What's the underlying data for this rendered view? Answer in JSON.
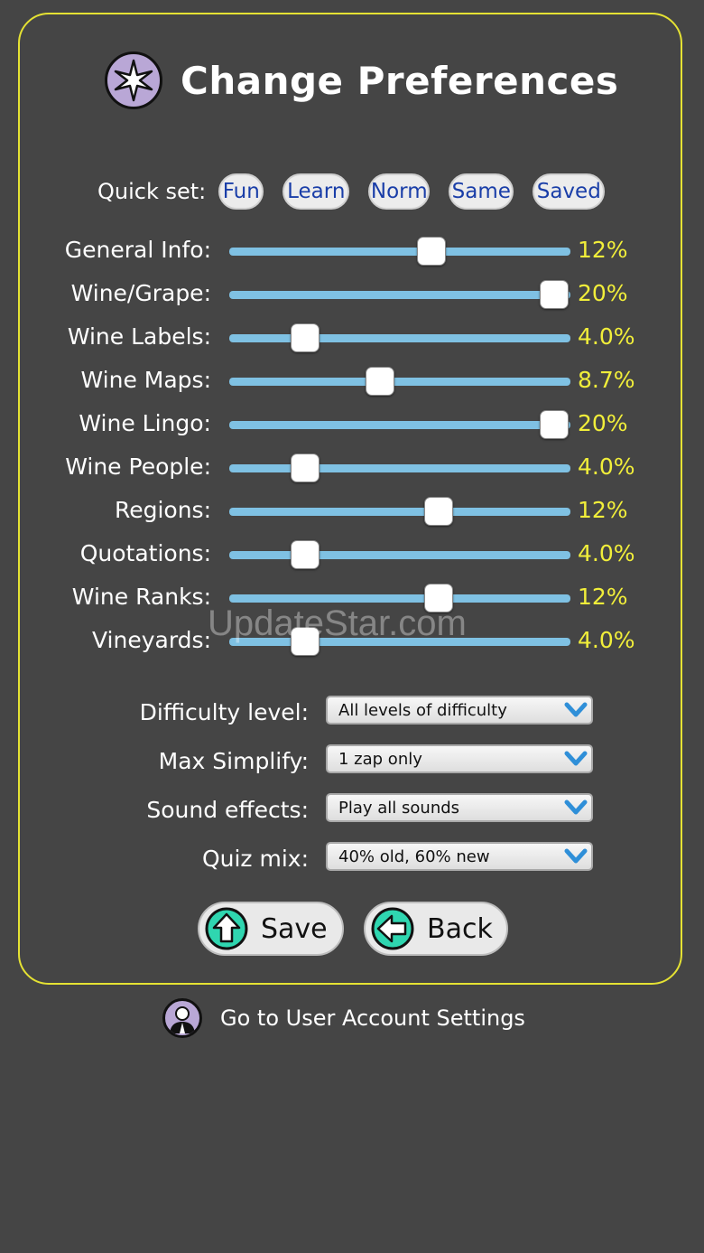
{
  "header": {
    "title": "Change Preferences",
    "icon": "star-compass-icon"
  },
  "quick_set": {
    "label": "Quick set:",
    "options": [
      "Fun",
      "Learn",
      "Norm",
      "Same",
      "Saved"
    ]
  },
  "sliders": [
    {
      "label": "General Info:",
      "value": "12%",
      "level": 0.59
    },
    {
      "label": "Wine/Grape:",
      "value": "20%",
      "level": 0.95
    },
    {
      "label": "Wine Labels:",
      "value": "4.0%",
      "level": 0.22
    },
    {
      "label": "Wine Maps:",
      "value": "8.7%",
      "level": 0.44
    },
    {
      "label": "Wine Lingo:",
      "value": "20%",
      "level": 0.95
    },
    {
      "label": "Wine People:",
      "value": "4.0%",
      "level": 0.22
    },
    {
      "label": "Regions:",
      "value": "12%",
      "level": 0.61
    },
    {
      "label": "Quotations:",
      "value": "4.0%",
      "level": 0.22
    },
    {
      "label": "Wine Ranks:",
      "value": "12%",
      "level": 0.61
    },
    {
      "label": "Vineyards:",
      "value": "4.0%",
      "level": 0.22
    }
  ],
  "settings": [
    {
      "label": "Difficulty level:",
      "selected": "All levels of difficulty"
    },
    {
      "label": "Max Simplify:",
      "selected": "1 zap only"
    },
    {
      "label": "Sound effects:",
      "selected": "Play all sounds"
    },
    {
      "label": "Quiz mix:",
      "selected": "40% old, 60% new"
    }
  ],
  "buttons": {
    "save_label": "Save",
    "back_label": "Back"
  },
  "account": {
    "label": "Go to User Account Settings"
  },
  "watermark": "UpdateStar.com",
  "colors": {
    "background": "#454545",
    "panel_border": "#e5e233",
    "value_text": "#f1ee3a",
    "track": "#7fc1e3",
    "pill_text": "#1a3ea8",
    "icon_accent": "#2fd6b0",
    "badge": "#b9a7d6"
  }
}
